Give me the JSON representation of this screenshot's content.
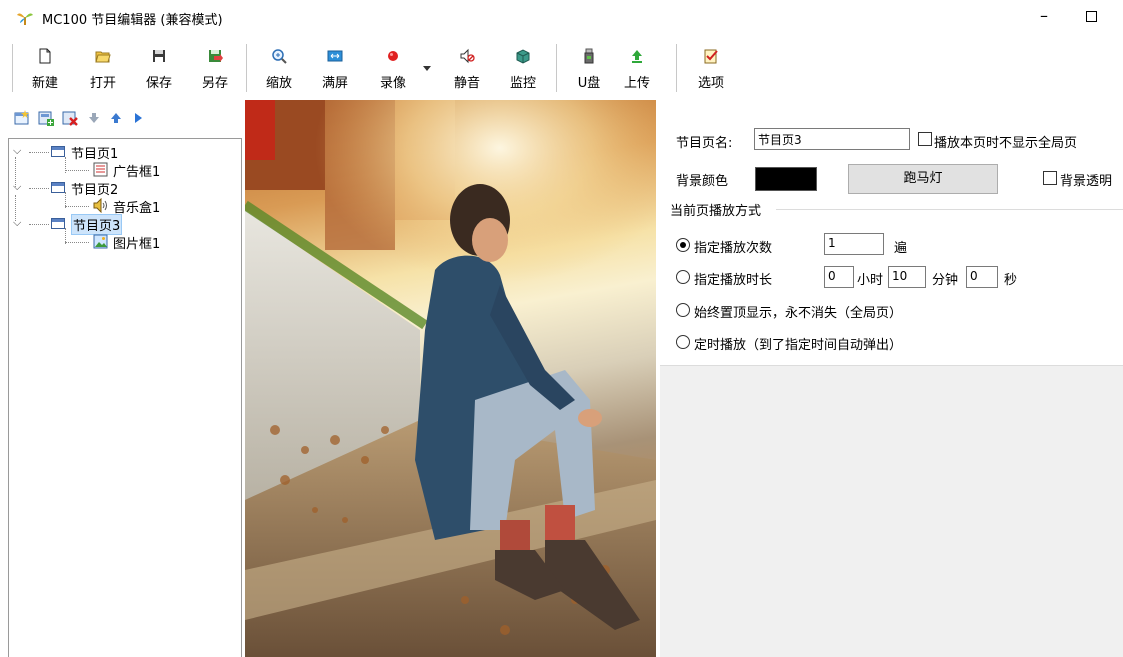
{
  "window": {
    "title": "MC100 节目编辑器 (兼容模式)",
    "minimize_label": "–"
  },
  "toolbar": {
    "new": "新建",
    "open": "打开",
    "save": "保存",
    "save_as": "另存",
    "zoom": "缩放",
    "fullscreen": "满屏",
    "record": "录像",
    "mute": "静音",
    "monitor": "监控",
    "udisk": "U盘",
    "upload": "上传",
    "options": "选项"
  },
  "tree": {
    "nodes": [
      {
        "label": "节目页1",
        "children": [
          {
            "label": "广告框1",
            "icon": "text-frame-icon"
          }
        ]
      },
      {
        "label": "节目页2",
        "children": [
          {
            "label": "音乐盒1",
            "icon": "speaker-icon"
          }
        ]
      },
      {
        "label": "节目页3",
        "selected": true,
        "children": [
          {
            "label": "图片框1",
            "icon": "picture-icon"
          }
        ]
      }
    ]
  },
  "props": {
    "page_name_label": "节目页名:",
    "page_name_value": "节目页3",
    "hide_global_label": "播放本页时不显示全局页",
    "bg_color_label": "背景颜色",
    "bg_color": "#000000",
    "marquee_label": "跑马灯",
    "bg_transparent_label": "背景透明",
    "play_mode_title": "当前页播放方式",
    "opt_count_label": "指定播放次数",
    "count_value": "1",
    "count_unit": "遍",
    "opt_duration_label": "指定播放时长",
    "hours_value": "0",
    "hours_unit": "小时",
    "minutes_value": "10",
    "minutes_unit": "分钟",
    "seconds_value": "0",
    "seconds_unit": "秒",
    "opt_pin_label": "始终置顶显示，永不消失（全局页）",
    "opt_timed_label": "定时播放（到了指定时间自动弹出）"
  },
  "colors": {
    "accent": "#5b82c4",
    "selection": "#cde4fb"
  }
}
